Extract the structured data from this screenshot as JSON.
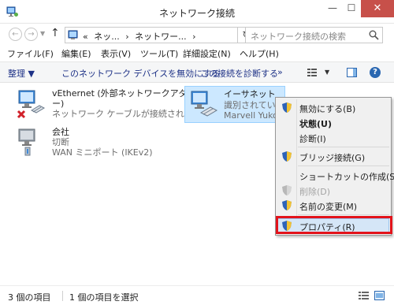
{
  "window": {
    "title": "ネットワーク接続",
    "minimize_glyph": "—",
    "maximize_glyph": "☐",
    "close_glyph": "✕"
  },
  "address": {
    "crumbs": [
      "«",
      "ネッ...",
      "›",
      "ネットワー...",
      "›"
    ],
    "search_placeholder": "ネットワーク接続の検索"
  },
  "menu": {
    "items": [
      "ファイル(F)",
      "編集(E)",
      "表示(V)",
      "ツール(T)",
      "詳細設定(N)",
      "ヘルプ(H)"
    ]
  },
  "commands": {
    "organize": "整理 ▼",
    "disable_device": "このネットワーク デバイスを無効にする",
    "diagnose": "この接続を診断する",
    "more": "»"
  },
  "adapters": [
    {
      "name_line1": "vEthernet (外部ネットワークアダプタ",
      "name_line2": "ー)",
      "status": "ネットワーク ケーブルが接続されていま...",
      "icon": "network-adapter-disconnected-icon"
    },
    {
      "name": "イーサネット",
      "status": "識別されていない",
      "device": "Marvell Yukon",
      "icon": "ethernet-adapter-icon",
      "selected": true
    },
    {
      "name": "会社",
      "status": "切断",
      "device": "WAN ミニポート (IKEv2)",
      "icon": "vpn-connection-icon"
    }
  ],
  "context_menu": {
    "items": [
      {
        "label": "無効にする(B)",
        "icon": "uac-shield-icon"
      },
      {
        "label": "状態(U)",
        "bold": true
      },
      {
        "label": "診断(I)"
      },
      {
        "label": "ブリッジ接続(G)",
        "icon": "uac-shield-icon"
      },
      {
        "label": "ショートカットの作成(S)"
      },
      {
        "label": "削除(D)",
        "icon": "uac-shield-icon",
        "disabled": true
      },
      {
        "label": "名前の変更(M)",
        "icon": "uac-shield-icon"
      },
      {
        "label": "プロパティ(R)",
        "icon": "uac-shield-icon",
        "highlighted": true
      }
    ]
  },
  "status": {
    "item_count": "3 個の項目",
    "selected_count": "1 個の項目を選択"
  },
  "colors": {
    "highlight_frame": "#e2131b",
    "selection": "#cce8ff",
    "close_button": "#c7504a"
  }
}
